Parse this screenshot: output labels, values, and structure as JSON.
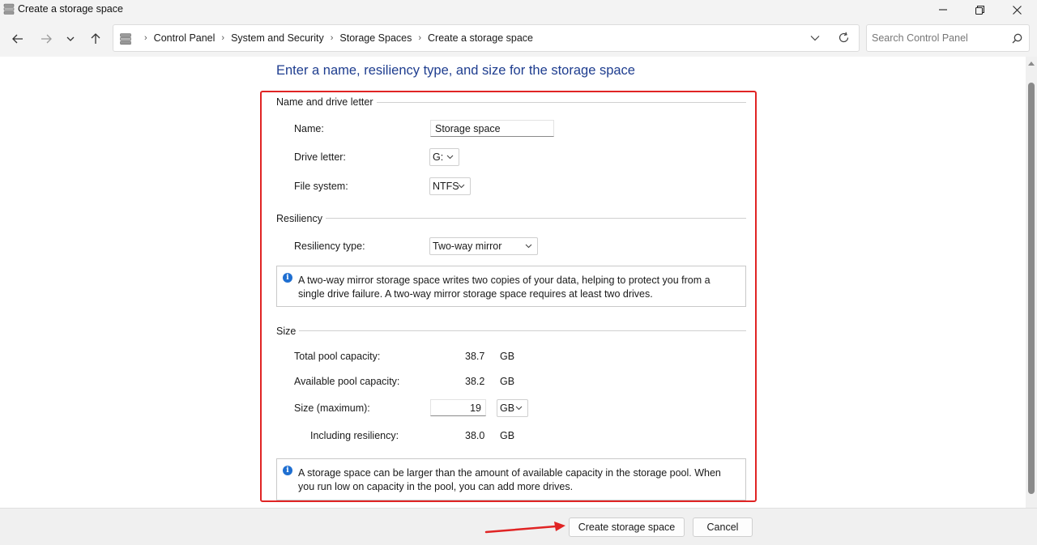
{
  "window": {
    "title": "Create a storage space",
    "app_icon": "storage-spaces-icon",
    "controls": [
      "minimize-icon",
      "restore-icon",
      "close-icon"
    ]
  },
  "nav": {
    "breadcrumb_icon": "storage-spaces-icon",
    "breadcrumbs": [
      "Control Panel",
      "System and Security",
      "Storage Spaces",
      "Create a storage space"
    ],
    "search_placeholder": "Search Control Panel"
  },
  "page": {
    "heading": "Enter a name, resiliency type, and size for the storage space"
  },
  "name_group": {
    "title": "Name and drive letter",
    "name_label": "Name:",
    "name_value": "Storage space",
    "drive_letter_label": "Drive letter:",
    "drive_letter_value": "G:",
    "file_system_label": "File system:",
    "file_system_value": "NTFS"
  },
  "resiliency_group": {
    "title": "Resiliency",
    "type_label": "Resiliency type:",
    "type_value": "Two-way mirror",
    "info_text": "A two-way mirror storage space writes two copies of your data, helping to protect you from a single drive failure. A two-way mirror storage space requires at least two drives."
  },
  "size_group": {
    "title": "Size",
    "total_label": "Total pool capacity:",
    "total_value": "38.7",
    "total_unit": "GB",
    "available_label": "Available pool capacity:",
    "available_value": "38.2",
    "available_unit": "GB",
    "size_label": "Size (maximum):",
    "size_value": "19",
    "size_unit": "GB",
    "including_label": "Including resiliency:",
    "including_value": "38.0",
    "including_unit": "GB",
    "info_text": "A storage space can be larger than the amount of available capacity in the storage pool. When you run low on capacity in the pool, you can add more drives."
  },
  "footer": {
    "create_label": "Create storage space",
    "cancel_label": "Cancel"
  },
  "colors": {
    "heading": "#1e3d8f",
    "annotation_red": "#e02424",
    "info_blue": "#1f6fd1"
  }
}
